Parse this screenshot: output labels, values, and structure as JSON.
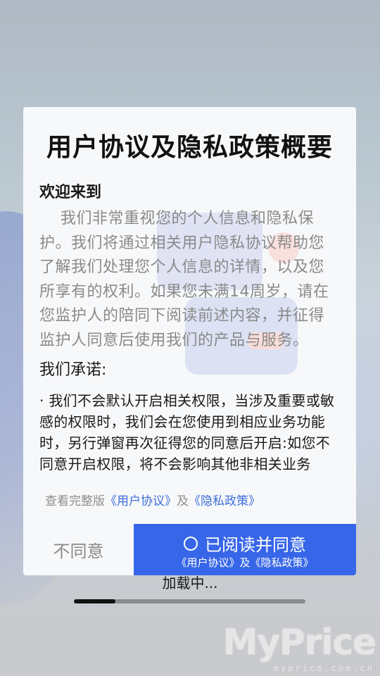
{
  "dialog": {
    "title": "用户协议及隐私政策概要",
    "welcome": "欢迎来到",
    "intro": "我们非常重视您的个人信息和隐私保护。我们将通过相关用户隐私协议帮助您了解我们处理您个人信息的详情，以及您所享有的权利。如果您未满14周岁，请在您监护人的陪同下阅读前述内容，并征得监护人同意后使用我们的产品与服务。",
    "promise_heading": "我们承诺:",
    "promise_body": "· 我们不会默认开启相关权限，当涉及重要或敏感的权限时，我们会在您使用到相应业务功能时，另行弹窗再次征得您的同意后开启:如您不同意开启权限，将不会影响其他非相关业务",
    "links_prefix": "查看完整版",
    "user_agreement_link": "《用户协议》",
    "links_and": "及",
    "privacy_policy_link": "《隐私政策》",
    "disagree_label": "不同意",
    "agree_label": "已阅读并同意",
    "agree_sub": "《用户协议》及《隐私政策》",
    "agree_radio_checked": false
  },
  "loading": {
    "text": "加载中...",
    "progress": 0.18
  },
  "watermark": {
    "brand": "MyPrice",
    "url": "myprice.com.cn"
  },
  "colors": {
    "accent": "#3766e8",
    "link": "#3e6fd9",
    "dialog_bg": "#f7f8fa"
  }
}
